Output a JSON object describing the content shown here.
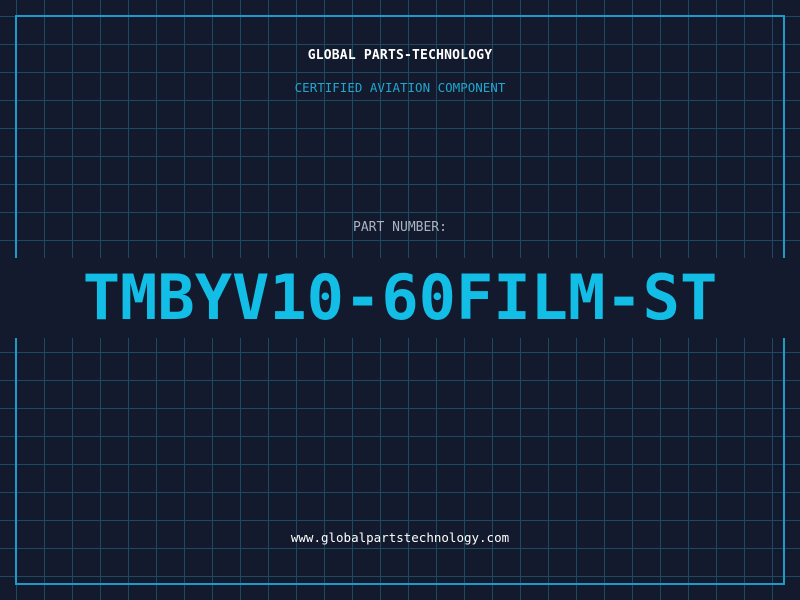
{
  "header": {
    "company": "GLOBAL PARTS-TECHNOLOGY",
    "tagline": "CERTIFIED AVIATION COMPONENT"
  },
  "part": {
    "label": "PART NUMBER:",
    "number": "TMBYV10-60FILM-ST"
  },
  "footer": {
    "website": "www.globalpartstechnology.com"
  },
  "colors": {
    "background": "#131a2d",
    "grid": "#1d4a63",
    "accent": "#12bde6",
    "frame": "#1b9cc8"
  }
}
